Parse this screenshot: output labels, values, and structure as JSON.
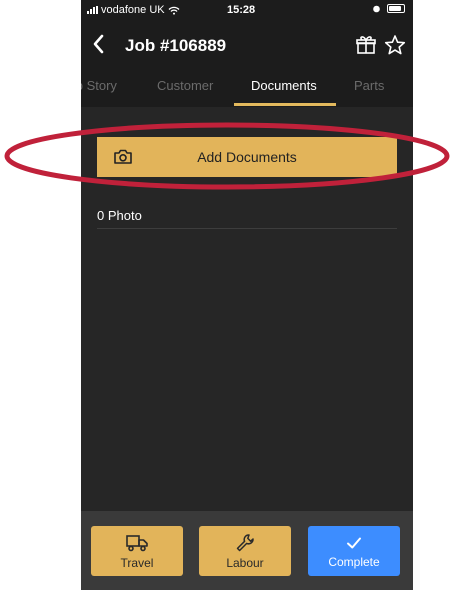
{
  "status_bar": {
    "carrier": "vodafone UK",
    "time": "15:28"
  },
  "header": {
    "title": "Job #106889"
  },
  "tabs": [
    {
      "label": "Job Story",
      "active": false
    },
    {
      "label": "Customer",
      "active": false
    },
    {
      "label": "Documents",
      "active": true
    },
    {
      "label": "Parts",
      "active": false
    }
  ],
  "documents": {
    "add_label": "Add Documents",
    "photo_count": "0 Photo"
  },
  "actions": [
    {
      "label": "Travel",
      "icon": "truck-icon"
    },
    {
      "label": "Labour",
      "icon": "wrench-icon"
    },
    {
      "label": "Complete",
      "icon": "check-icon"
    }
  ],
  "colors": {
    "accent": "#e2b45a",
    "complete": "#3d8dff",
    "annotation": "#c0213a",
    "background": "#262626"
  }
}
